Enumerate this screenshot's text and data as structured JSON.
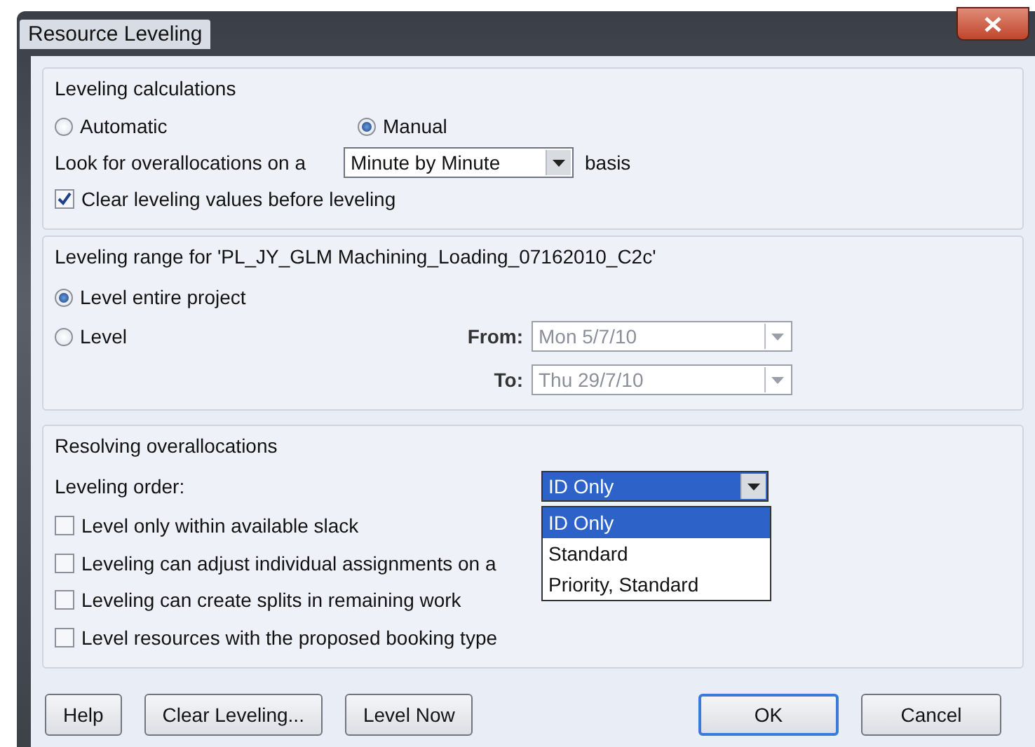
{
  "window": {
    "title": "Resource Leveling"
  },
  "calculations": {
    "heading": "Leveling calculations",
    "modes": [
      {
        "label": "Automatic",
        "selected": false
      },
      {
        "label": "Manual",
        "selected": true
      }
    ],
    "look_for_label": "Look for overallocations on a",
    "basis_value": "Minute by Minute",
    "basis_suffix": "basis",
    "clear_values": {
      "label": "Clear leveling values before leveling",
      "checked": true
    }
  },
  "range": {
    "heading": "Leveling range for 'PL_JY_GLM Machining_Loading_07162010_C2c'",
    "options": [
      {
        "label": "Level entire project",
        "selected": true
      },
      {
        "label": "Level",
        "selected": false
      }
    ],
    "from": {
      "label": "From:",
      "value": "Mon 5/7/10",
      "disabled": true
    },
    "to": {
      "label": "To:",
      "value": "Thu 29/7/10",
      "disabled": true
    }
  },
  "resolving": {
    "heading": "Resolving overallocations",
    "order_label": "Leveling order:",
    "order_value": "ID Only",
    "order_expanded": true,
    "order_options": [
      {
        "label": "ID Only",
        "selected": true
      },
      {
        "label": "Standard",
        "selected": false
      },
      {
        "label": "Priority, Standard",
        "selected": false
      }
    ],
    "options": [
      {
        "label": "Level only within available slack",
        "checked": false
      },
      {
        "label": "Leveling can adjust individual assignments on a",
        "checked": false
      },
      {
        "label": "Leveling can create splits in remaining work",
        "checked": false
      },
      {
        "label": "Level resources with the proposed booking type",
        "checked": false
      }
    ]
  },
  "buttons": {
    "actions": [
      {
        "label": "Help",
        "default": false
      },
      {
        "label": "Clear Leveling...",
        "default": false
      },
      {
        "label": "Level Now",
        "default": false
      }
    ],
    "confirm": [
      {
        "label": "OK",
        "default": true
      },
      {
        "label": "Cancel",
        "default": false
      }
    ]
  }
}
